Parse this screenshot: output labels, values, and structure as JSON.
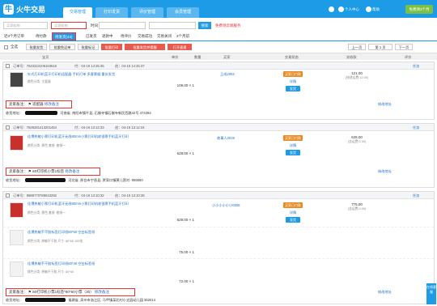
{
  "header": {
    "logo_text": "火牛交易",
    "nav": [
      "交易管理",
      "打印发货",
      "评价管理",
      "会员管理"
    ],
    "right": {
      "notifications": "消息",
      "user_center": "个人中心",
      "help": "帮助",
      "upgrade_button": "免费领3个月"
    }
  },
  "search": {
    "placeholder_1": "买家昵称",
    "placeholder_2": "买家昵称",
    "time_label": "时间",
    "search_button": "搜索",
    "merge_link": "免费领云端服务"
  },
  "status_tabs": [
    "近3个月订单",
    "待付款",
    "待发货(43)",
    "已发货",
    "退款中",
    "待评价",
    "交易成功",
    "交易关闭",
    "3个月前"
  ],
  "actions": {
    "select_all": "全选",
    "buttons": [
      "批量发货",
      "批量免运单",
      "批量标记",
      "批量打印",
      "批量发货并提醒",
      "打开速通"
    ],
    "pager_prev": "上一页",
    "pager_current": "第 1 页",
    "pager_next": "下一页"
  },
  "columns": [
    "宝贝",
    "单价",
    "数量",
    "买家",
    "交易状态",
    "实收款",
    "评价"
  ],
  "orders": [
    {
      "order_no": "订单号：7643223106163516",
      "paid_time": "付：04-19 14:25:35",
      "created_time": "创：04-19 14:25:37",
      "tag": "任务",
      "items": [
        {
          "title": "针式打印机蓝牙打印机适配器 手机打单 多客票据 重庆发货",
          "subtitle": "颜色分类: 主要器",
          "price": "109.00 × 1"
        }
      ],
      "buyer": "王成2002",
      "status": "买家已付款",
      "status_buttons": [
        "详情",
        "发货"
      ],
      "total": "121.00",
      "total_sub": "(快递运费:12.00)",
      "seller_note_label": "卖家备注：",
      "seller_note": "适配器",
      "note_action": "修改备注",
      "addr_label": "收货地址：",
      "addr": "河南省, 南阳市镇平县, 石佛寺镇石佛寺新民西路42号 474284",
      "right_action": "修改地址"
    },
    {
      "order_no": "订单号：7629281413201454",
      "paid_time": "付：04-19 13:12:33",
      "created_time": "创：04-19 13:12:44",
      "tag": "任务",
      "items": [
        {
          "title": "佳博热敏小票打印机蓝牙无线80mm小票打印机收银票手机蓝牙打印",
          "subtitle": "颜色分类: 黑色 套餐: 套餐一",
          "price": "628.00 × 1"
        }
      ],
      "buyer": "故事人2019",
      "status": "买家已付款",
      "status_buttons": [
        "详情",
        "发货"
      ],
      "total": "628.00",
      "total_sub": "(含运费:0.00)",
      "seller_note_label": "卖家备注：",
      "seller_note": "80打印机小票1标签",
      "note_action": "修改备注",
      "addr_label": "收货地址：",
      "addr": "河北省, 邢台市宁晋县, 贾家口镇黄儿营村 -055550",
      "right_action": "修改地址"
    },
    {
      "order_no": "订单号：9889770789043292",
      "paid_time": "付：04-19 13:10:32",
      "created_time": "创：04-19 13:10:38",
      "tag": "任务",
      "items": [
        {
          "title": "佳博热敏小票打印机蓝牙无线80mm小票打印机收银票手机蓝牙打印",
          "subtitle": "颜色分类: 黑色 套餐: 套餐一",
          "price": "628.00 × 1"
        },
        {
          "title": "佳博热敏不干胶标签打印纸80*60 空白标签纸",
          "subtitle": "颜色分类: 热敏不干胶 尺寸: 80*60 100张",
          "price": "75.00 × 1"
        },
        {
          "title": "佳博热敏不干胶标签打印纸60*40 空白标签纸",
          "subtitle": "颜色分类: 热敏不干胶 尺寸: 60*40",
          "price": "72.00 × 1"
        }
      ],
      "buyer": "小小小小小小0508",
      "status": "买家已付款",
      "status_buttons": [
        "详情",
        "发货"
      ],
      "total": "775.00",
      "total_sub": "(含运费:0.00)",
      "seller_note_label": "卖家备注：",
      "seller_note": "80打印机小票1标签*80*60小票（30）",
      "note_action": "修改备注",
      "addr_label": "收货地址：",
      "addr": "福建省, 泉州市洛江区, 马甲镇某北村小丈园幼儿园 362014",
      "right_action": "修改地址"
    }
  ],
  "chat_widget": "在线客服",
  "colors": {
    "brand_blue": "#1e9be6",
    "accent_red": "#e33333",
    "orange": "#e8891f"
  }
}
